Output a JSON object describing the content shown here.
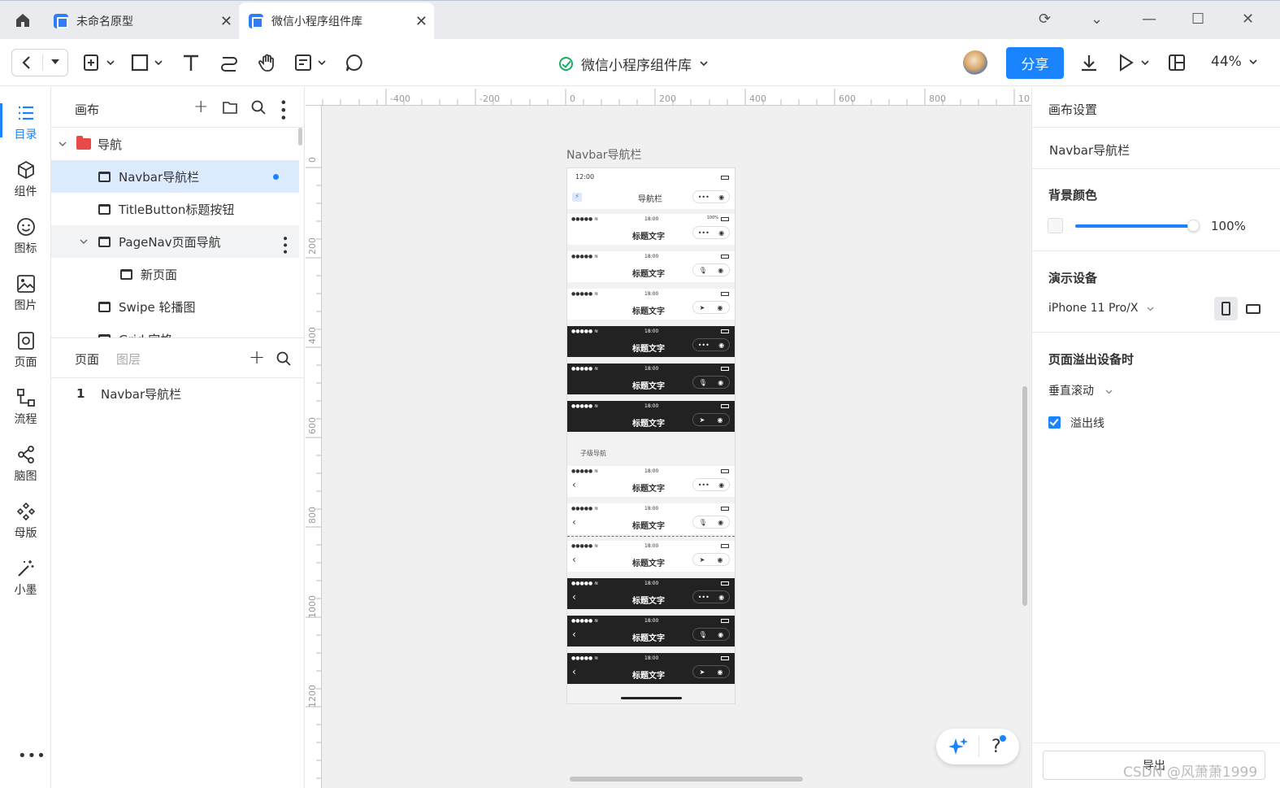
{
  "tabs": [
    {
      "label": "未命名原型"
    },
    {
      "label": "微信小程序组件库"
    }
  ],
  "toolbar": {
    "doc_title": "微信小程序组件库",
    "share_label": "分享",
    "zoom": "44%"
  },
  "rail": [
    {
      "label": "目录",
      "icon": "list-icon",
      "active": true
    },
    {
      "label": "组件",
      "icon": "cube-icon"
    },
    {
      "label": "图标",
      "icon": "smile-icon"
    },
    {
      "label": "图片",
      "icon": "image-icon"
    },
    {
      "label": "页面",
      "icon": "page-icon"
    },
    {
      "label": "流程",
      "icon": "flow-icon"
    },
    {
      "label": "脑图",
      "icon": "mindmap-icon"
    },
    {
      "label": "母版",
      "icon": "master-icon"
    },
    {
      "label": "小墨",
      "icon": "magic-wand-icon"
    }
  ],
  "left_panel": {
    "title": "画布",
    "tree": [
      {
        "label": "导航",
        "type": "folder"
      },
      {
        "label": "Navbar导航栏",
        "type": "page",
        "selected": true
      },
      {
        "label": "TitleButton标题按钮",
        "type": "page"
      },
      {
        "label": "PageNav页面导航",
        "type": "page"
      },
      {
        "label": "新页面",
        "type": "page"
      },
      {
        "label": "Swipe 轮播图",
        "type": "page"
      },
      {
        "label": "Grid 宫格",
        "type": "page"
      }
    ],
    "pages_tab": "页面",
    "layers_tab": "图层",
    "page_list": [
      {
        "num": "1",
        "label": "Navbar导航栏"
      }
    ]
  },
  "ruler": {
    "top": [
      "-400",
      "-200",
      "0",
      "200",
      "400",
      "600",
      "800",
      "10"
    ],
    "left": [
      "0",
      "200",
      "400",
      "600",
      "800",
      "1000",
      "1200"
    ]
  },
  "canvas": {
    "frame_label": "Navbar导航栏",
    "first_time": "12:00",
    "first_title": "导航栏",
    "time": "18:00",
    "battery_pct": "100%",
    "bar_title": "标题文字",
    "sub_label": "子级导航"
  },
  "right_panel": {
    "canvas_settings": "画布设置",
    "page_name": "Navbar导航栏",
    "bg_color_label": "背景颜色",
    "opacity": "100%",
    "device_label": "演示设备",
    "device_value": "iPhone 11 Pro/X",
    "overflow_label": "页面溢出设备时",
    "overflow_value": "垂直滚动",
    "overflow_line": "溢出线",
    "export_label": "导出"
  },
  "watermark": "CSDN @风萧萧1999",
  "colors": {
    "accent": "#1a84ff",
    "folder": "#e84a47",
    "ok": "#1aad5e"
  }
}
